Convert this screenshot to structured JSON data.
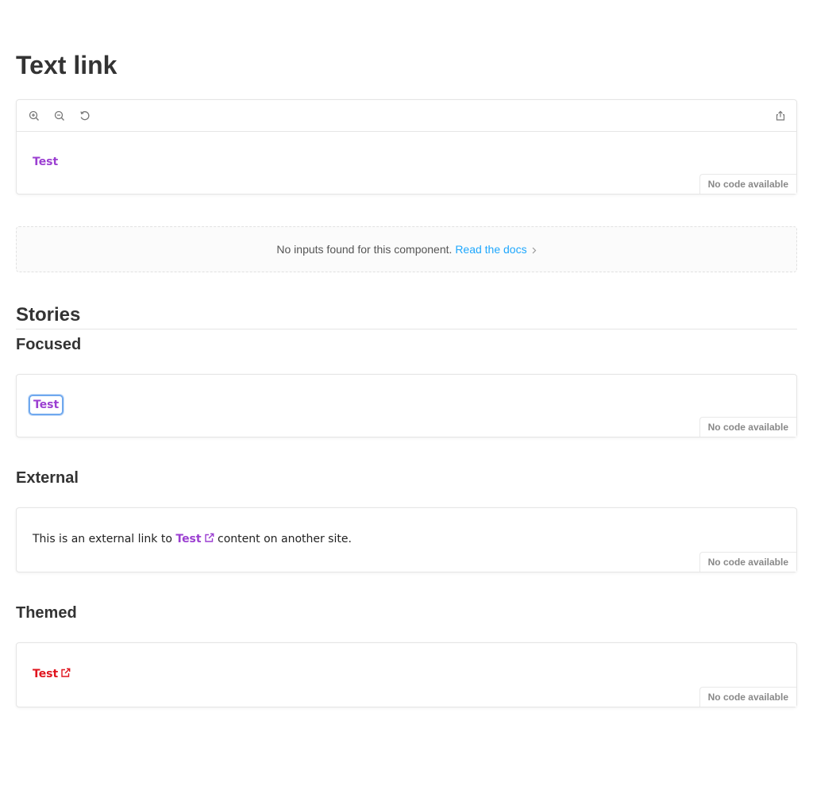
{
  "page": {
    "title": "Text link"
  },
  "toolbar": {
    "zoom_in": "zoom-in-icon",
    "zoom_out": "zoom-out-icon",
    "reset": "reset-zoom-icon",
    "share": "share-icon"
  },
  "primary": {
    "link_text": "Test",
    "no_code": "No code available"
  },
  "inputs_notice": {
    "text": "No inputs found for this component.",
    "link": "Read the docs"
  },
  "stories": {
    "heading": "Stories",
    "focused": {
      "title": "Focused",
      "link_text": "Test",
      "no_code": "No code available"
    },
    "external": {
      "title": "External",
      "prefix": "This is an external link to",
      "link_text": "Test",
      "suffix": "content on another site.",
      "no_code": "No code available"
    },
    "themed": {
      "title": "Themed",
      "link_text": "Test",
      "no_code": "No code available"
    }
  },
  "colors": {
    "link": "#9b3fd1",
    "themed_link": "#e0141e",
    "docs_link": "#1ea7fd",
    "focus_ring": "#6fa8ee"
  }
}
